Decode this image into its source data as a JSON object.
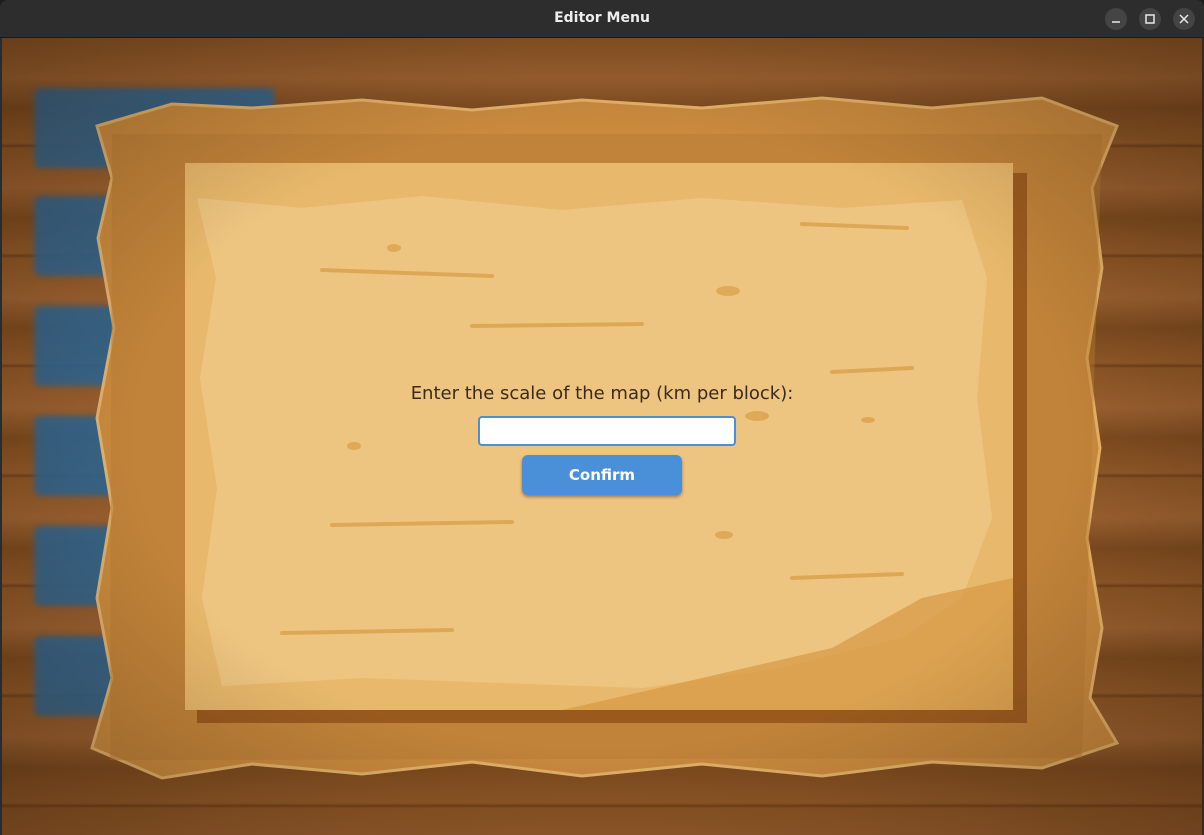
{
  "window": {
    "title": "Editor Menu",
    "controls": {
      "minimize": "minimize-icon",
      "maximize": "maximize-icon",
      "close": "close-icon"
    }
  },
  "dialog": {
    "prompt": "Enter the scale of the map (km per block):",
    "input_value": "",
    "confirm_label": "Confirm"
  },
  "colors": {
    "accent": "#4a90d9",
    "parchment": "#e3b26a",
    "frame": "#c98a3e",
    "wood": "#8a5424",
    "titlebar": "#2d2d2d"
  }
}
